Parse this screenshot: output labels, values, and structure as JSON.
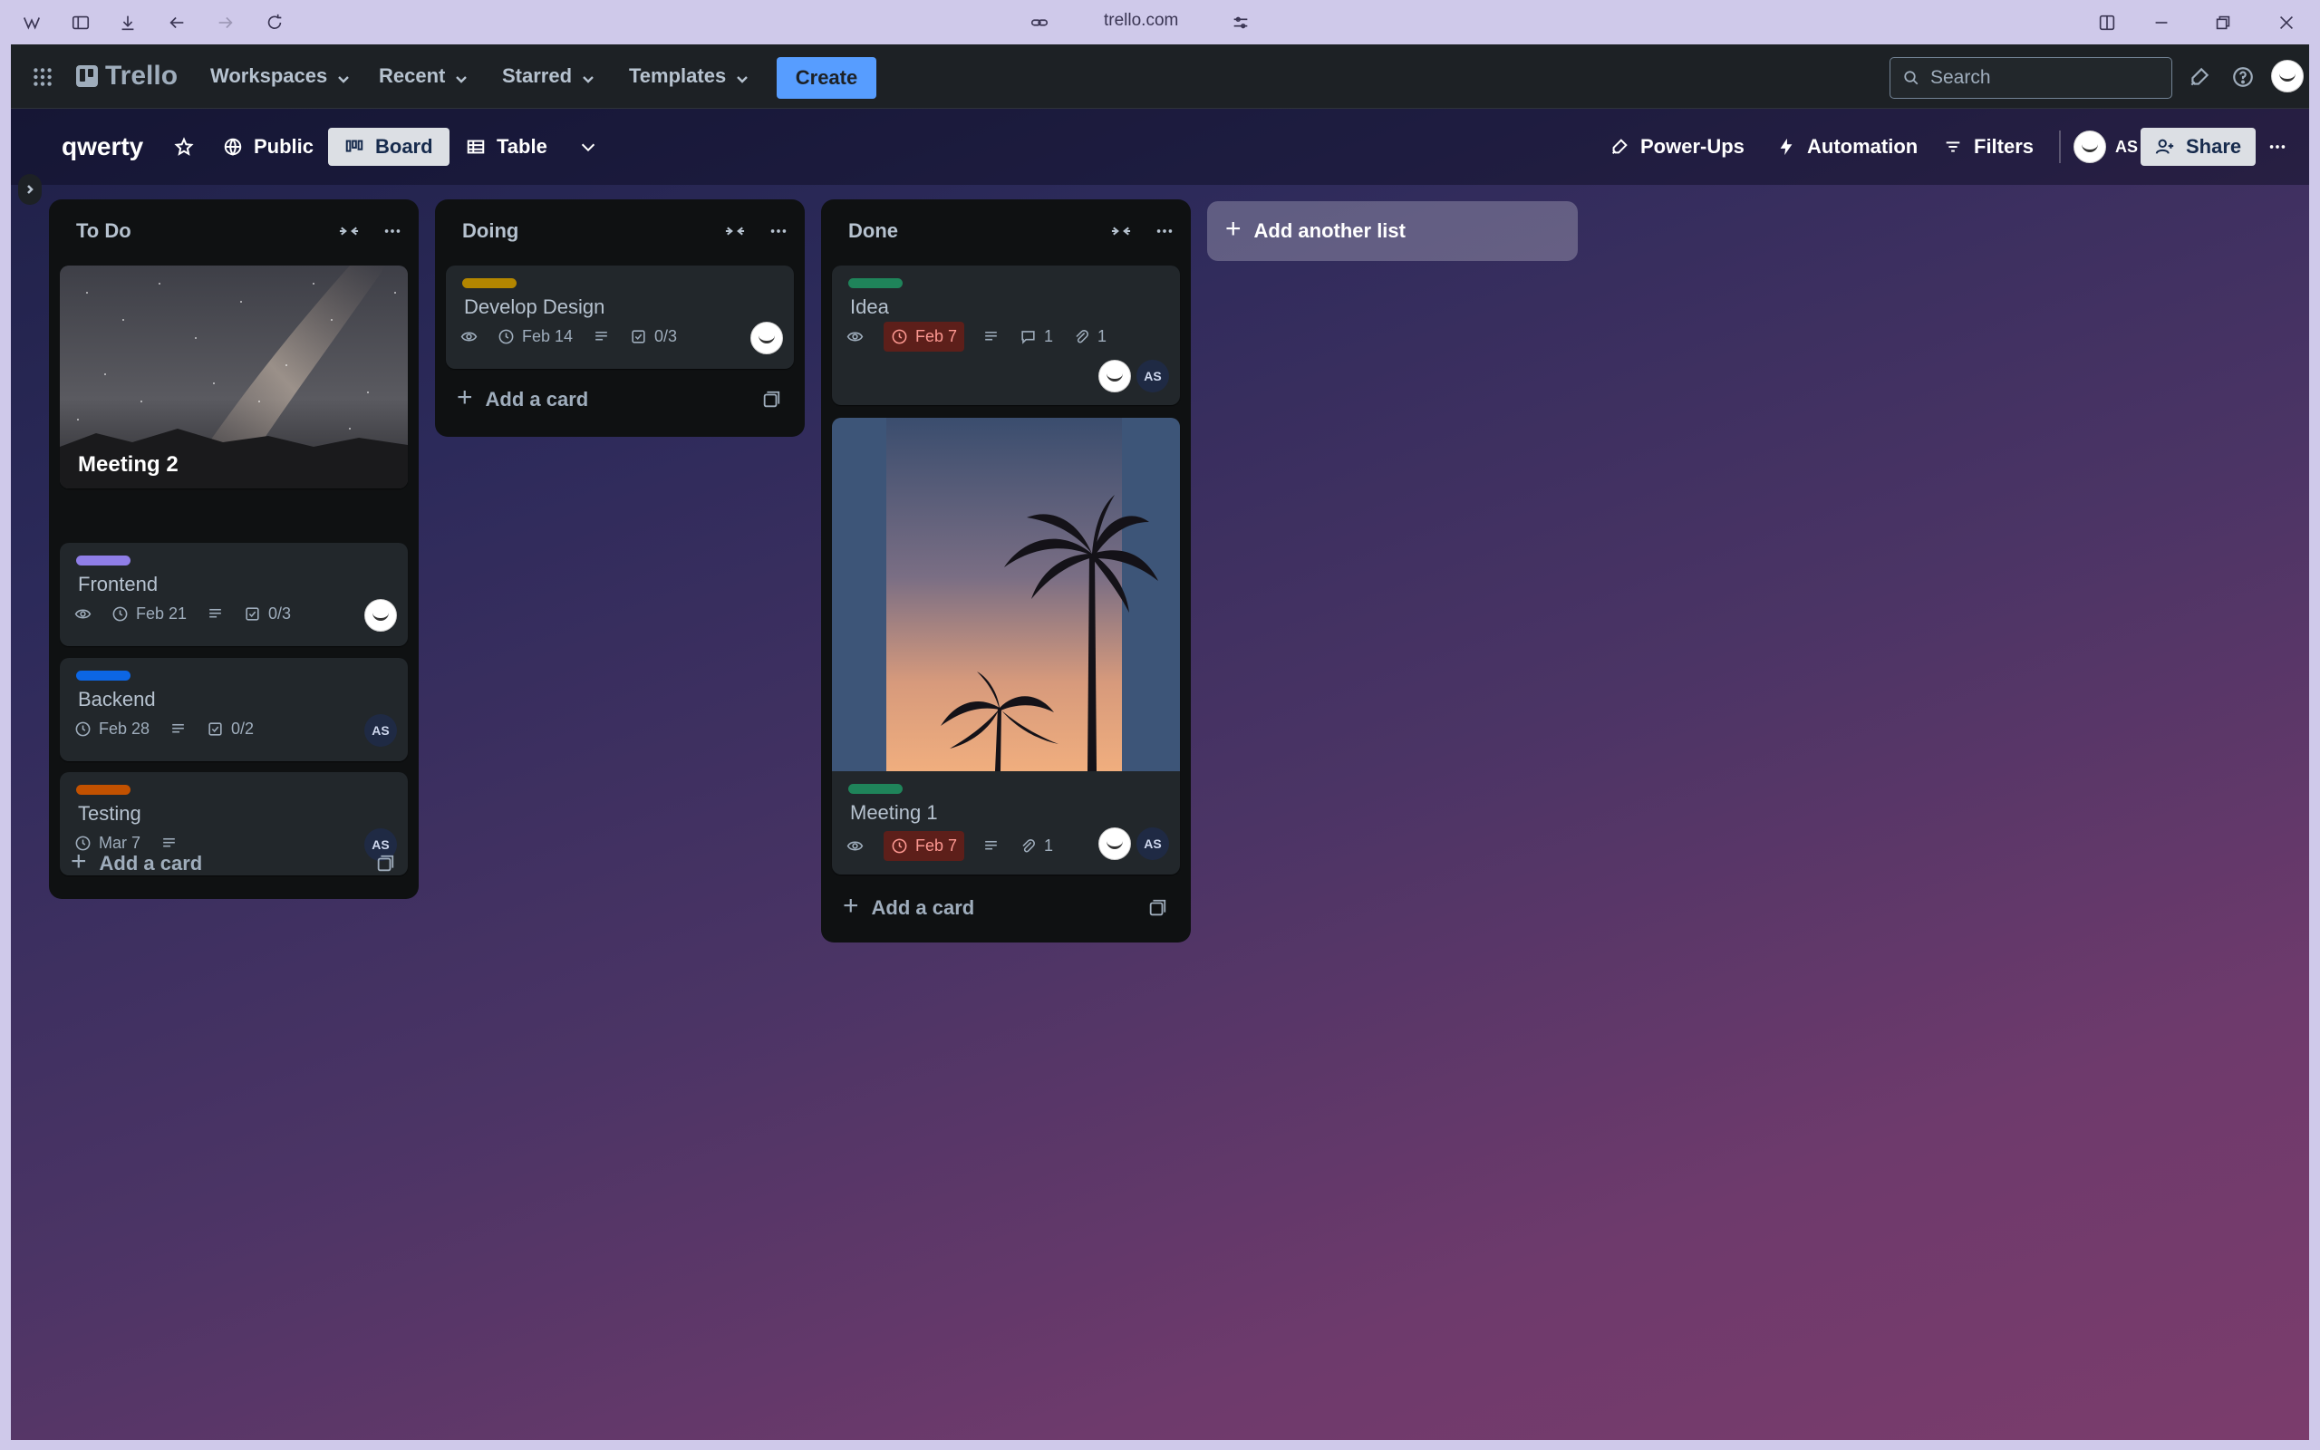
{
  "browser": {
    "url": "trello.com"
  },
  "topnav": {
    "brand": "Trello",
    "menus": [
      "Workspaces",
      "Recent",
      "Starred",
      "Templates"
    ],
    "create_label": "Create",
    "search_placeholder": "Search"
  },
  "board": {
    "title": "qwerty",
    "visibility": "Public",
    "view_board": "Board",
    "view_table": "Table",
    "power_ups": "Power-Ups",
    "automation": "Automation",
    "filters": "Filters",
    "member_initials": "AS",
    "share_label": "Share"
  },
  "lists": [
    {
      "name": "To Do",
      "add_card_label": "Add a card",
      "cards": [
        {
          "title": "Meeting 2",
          "cover": "night-sky"
        },
        {
          "title": "Frontend",
          "label_color": "#8f7ee7",
          "due": "Feb 21",
          "checklist": "0/3",
          "watch": true,
          "description": true,
          "members": [
            "face"
          ]
        },
        {
          "title": "Backend",
          "label_color": "#0c66e4",
          "due": "Feb 28",
          "checklist": "0/2",
          "description": true,
          "members": [
            "AS"
          ]
        },
        {
          "title": "Testing",
          "label_color": "#c25100",
          "due": "Mar 7",
          "description": true,
          "members": [
            "AS"
          ]
        }
      ]
    },
    {
      "name": "Doing",
      "add_card_label": "Add a card",
      "cards": [
        {
          "title": "Develop Design",
          "label_color": "#b38600",
          "due": "Feb 14",
          "checklist": "0/3",
          "watch": true,
          "description": true,
          "members": [
            "face"
          ]
        }
      ]
    },
    {
      "name": "Done",
      "add_card_label": "Add a card",
      "cards": [
        {
          "title": "Idea",
          "label_color": "#1f845a",
          "due": "Feb 7",
          "comments": "1",
          "attachments": "1",
          "watch": true,
          "description": true,
          "members": [
            "face",
            "AS"
          ]
        },
        {
          "title": "Meeting 1",
          "cover": "palm-sunset",
          "label_color": "#1f845a",
          "due": "Feb 7",
          "attachments": "1",
          "watch": true,
          "description": true,
          "members": [
            "face",
            "AS"
          ]
        }
      ]
    }
  ],
  "add_list_label": "Add another list",
  "colors": {
    "create": "#579dff",
    "overdue_bg": "#5d1f1a",
    "overdue_text": "#fd9891"
  }
}
